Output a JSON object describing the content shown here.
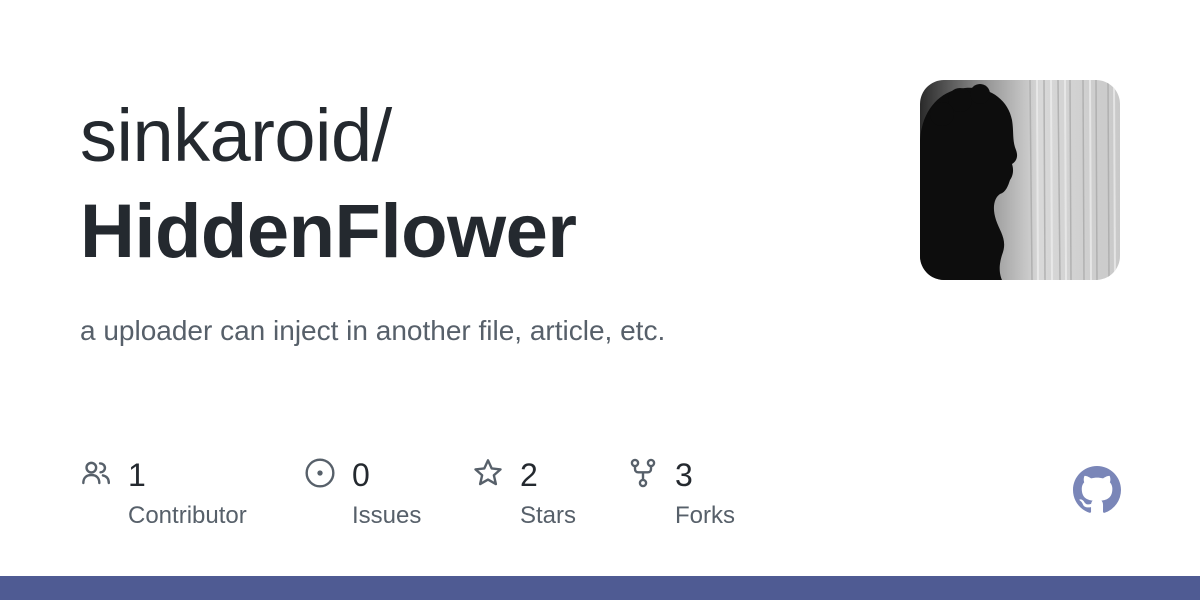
{
  "repository": {
    "owner": "sinkaroid/",
    "name": "HiddenFlower",
    "description": "a uploader can inject in another file, article, etc."
  },
  "avatar": {
    "icon": "avatar-silhouette"
  },
  "stats": {
    "contributors": {
      "count": "1",
      "label": "Contributor",
      "icon": "people-icon"
    },
    "issues": {
      "count": "0",
      "label": "Issues",
      "icon": "issue-opened-icon"
    },
    "stars": {
      "count": "2",
      "label": "Stars",
      "icon": "star-icon"
    },
    "forks": {
      "count": "3",
      "label": "Forks",
      "icon": "repo-forked-icon"
    }
  },
  "branding": {
    "logo_icon": "github-logo-icon",
    "accent_color": "#4f5b93",
    "logo_color": "#7a86b8",
    "text_color": "#24292f",
    "muted_color": "#57606a"
  }
}
